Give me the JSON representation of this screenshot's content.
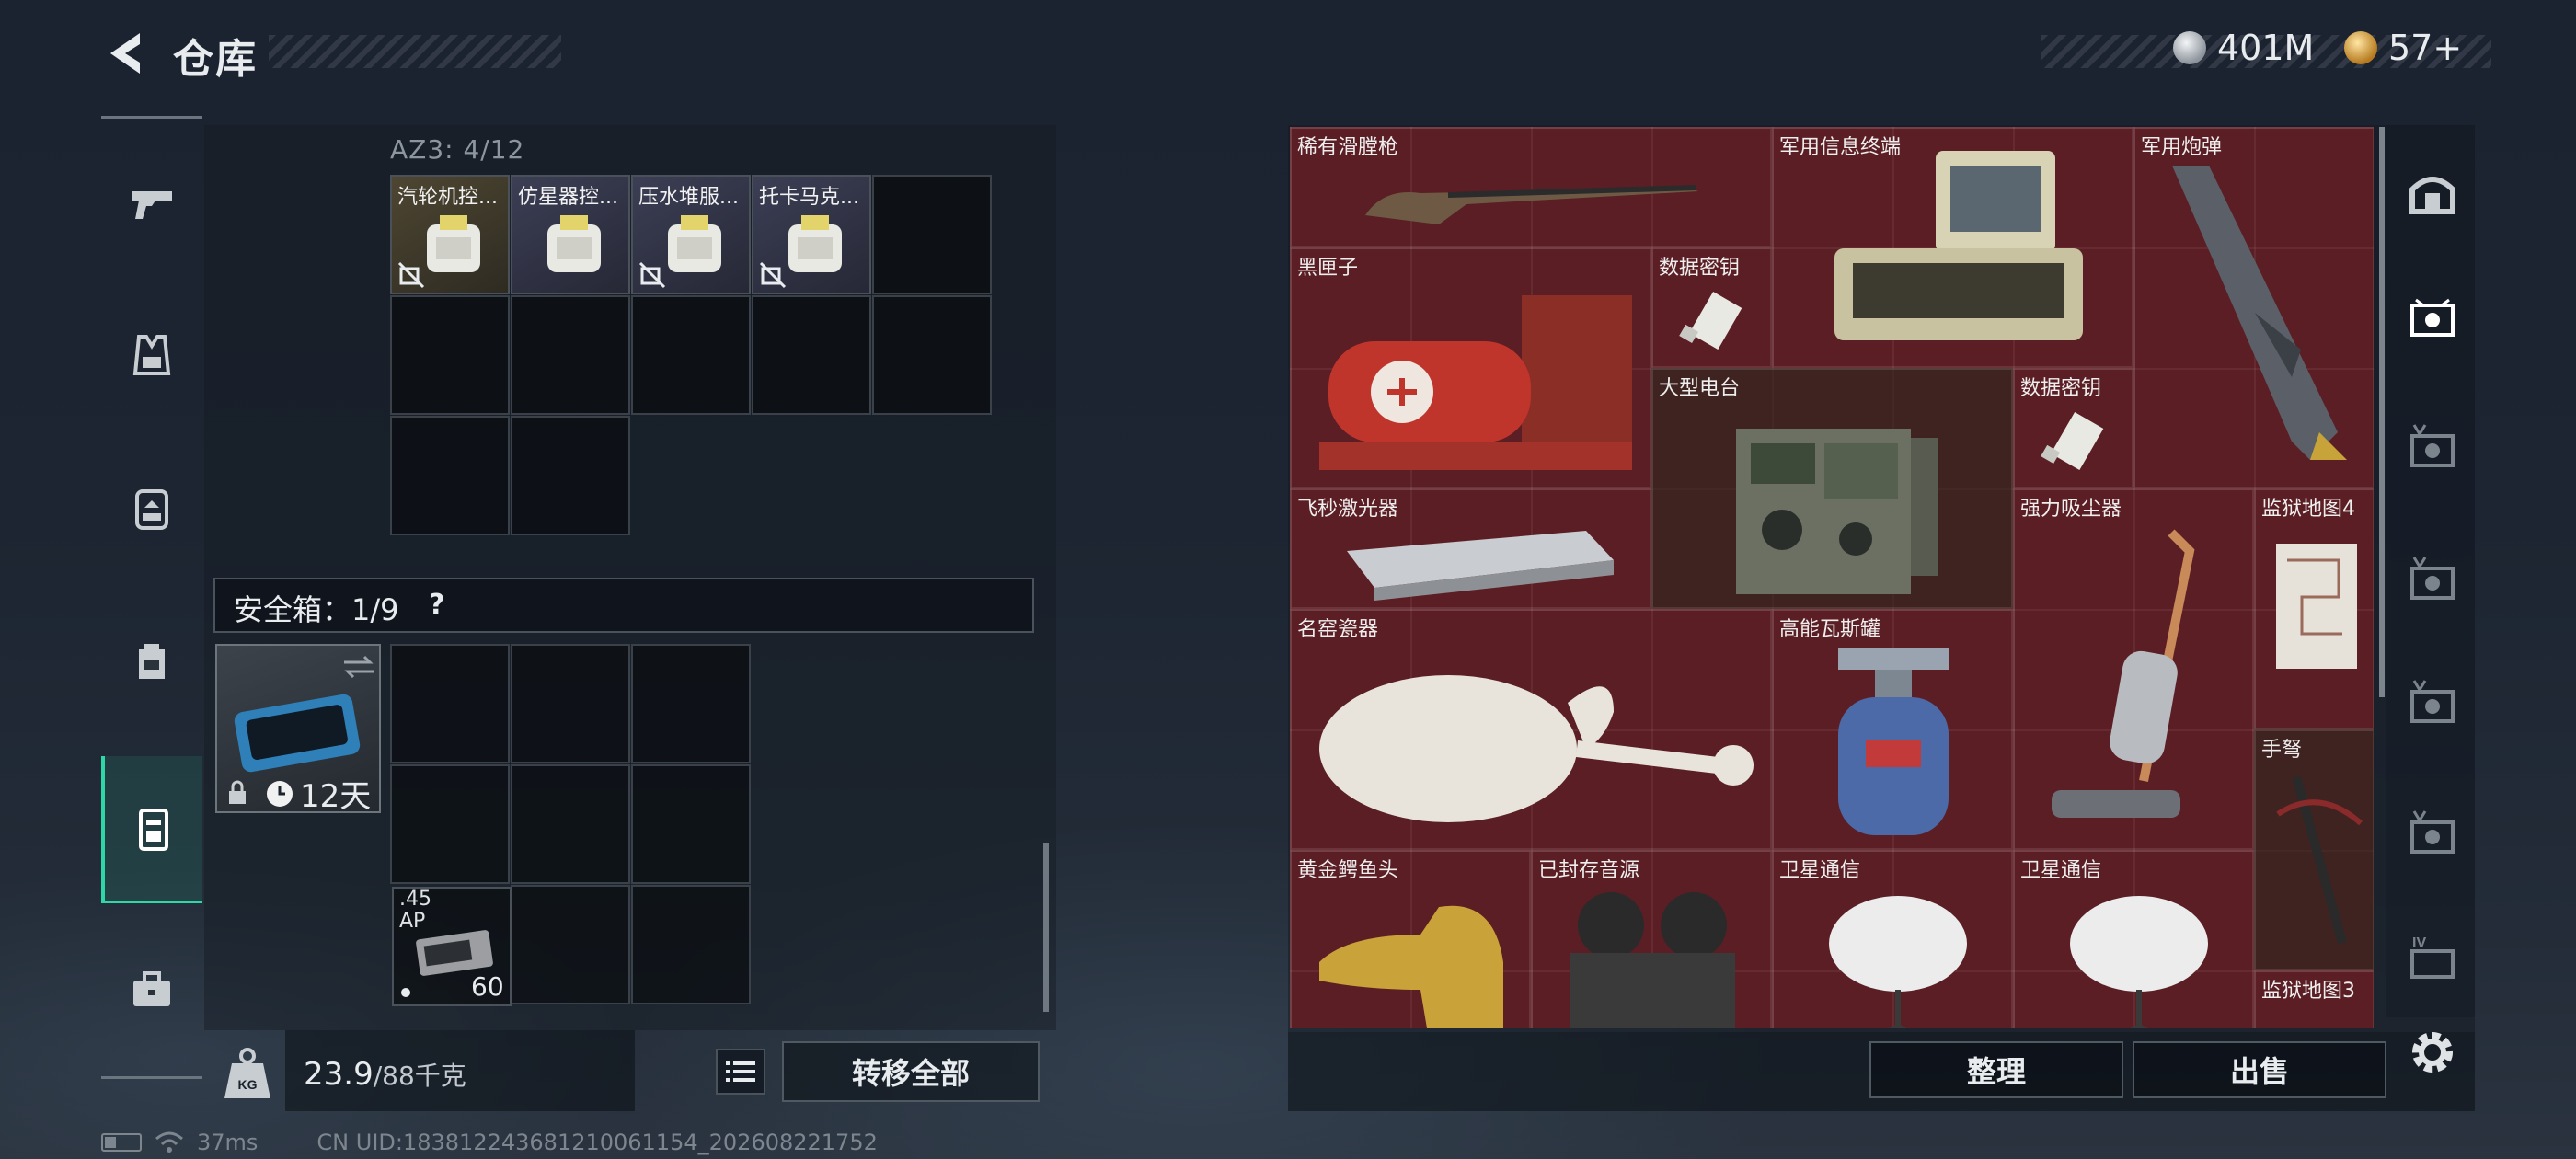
{
  "header": {
    "title": "仓库",
    "back_icon": "back-arrow-icon"
  },
  "currency": [
    {
      "value": "401M",
      "icon": "silver-coin-icon",
      "color": "#c9ced4"
    },
    {
      "value": "57+",
      "icon": "gold-coin-icon",
      "color": "#d9a441"
    }
  ],
  "categories": [
    {
      "name": "weapon",
      "icon": "pistol-icon"
    },
    {
      "name": "armor",
      "icon": "vest-icon"
    },
    {
      "name": "helmet-rig",
      "icon": "chest-rig-icon"
    },
    {
      "name": "backpack",
      "icon": "backpack-icon"
    },
    {
      "name": "container",
      "icon": "container-icon",
      "active": true
    },
    {
      "name": "toolbox",
      "icon": "toolbox-icon"
    }
  ],
  "pouch": {
    "label": "AZ3: 4/12",
    "items": [
      {
        "label": "汽轮机控..."
      },
      {
        "label": "仿星器控..."
      },
      {
        "label": "压水堆服..."
      },
      {
        "label": "托卡马克..."
      }
    ]
  },
  "safe_box": {
    "label": "安全箱：1/9",
    "help": "?",
    "days": "12天",
    "ammo": {
      "label_line1": ".45",
      "label_line2": "AP",
      "qty": "60"
    }
  },
  "footer_left": {
    "weight": "23.9",
    "weight_max": "/88千克",
    "transfer_all": "转移全部"
  },
  "status": {
    "ping": "37ms",
    "uid": "CN UID:183812243681210061154_202608221752"
  },
  "storage": {
    "items": [
      {
        "name": "稀有滑膛枪"
      },
      {
        "name": "军用信息终端"
      },
      {
        "name": "军用炮弹"
      },
      {
        "name": "黑匣子"
      },
      {
        "name": "数据密钥"
      },
      {
        "name": "大型电台"
      },
      {
        "name": "数据密钥"
      },
      {
        "name": "飞秒激光器"
      },
      {
        "name": "强力吸尘器"
      },
      {
        "name": "监狱地图4"
      },
      {
        "name": "名窑瓷器"
      },
      {
        "name": "高能瓦斯罐"
      },
      {
        "name": "手弩"
      },
      {
        "name": "黄金鳄鱼头"
      },
      {
        "name": "已封存音源"
      },
      {
        "name": "卫星通信"
      },
      {
        "name": "卫星通信"
      },
      {
        "name": "监狱地图3"
      }
    ]
  },
  "footer_right": {
    "sort": "整理",
    "sell": "出售"
  },
  "right_tabs": [
    {
      "icon": "safehouse-icon"
    },
    {
      "icon": "storage-tab-1-icon",
      "active": true
    },
    {
      "icon": "storage-tab-2-icon"
    },
    {
      "icon": "storage-tab-3-icon"
    },
    {
      "icon": "storage-tab-4-icon"
    },
    {
      "icon": "storage-tab-5-icon"
    },
    {
      "icon": "storage-tab-iv-icon",
      "badge": "IV"
    },
    {
      "icon": "settings-gear-icon"
    }
  ],
  "colors": {
    "accent": "#2fd6a6",
    "storage_bg": "#5b1e24"
  }
}
